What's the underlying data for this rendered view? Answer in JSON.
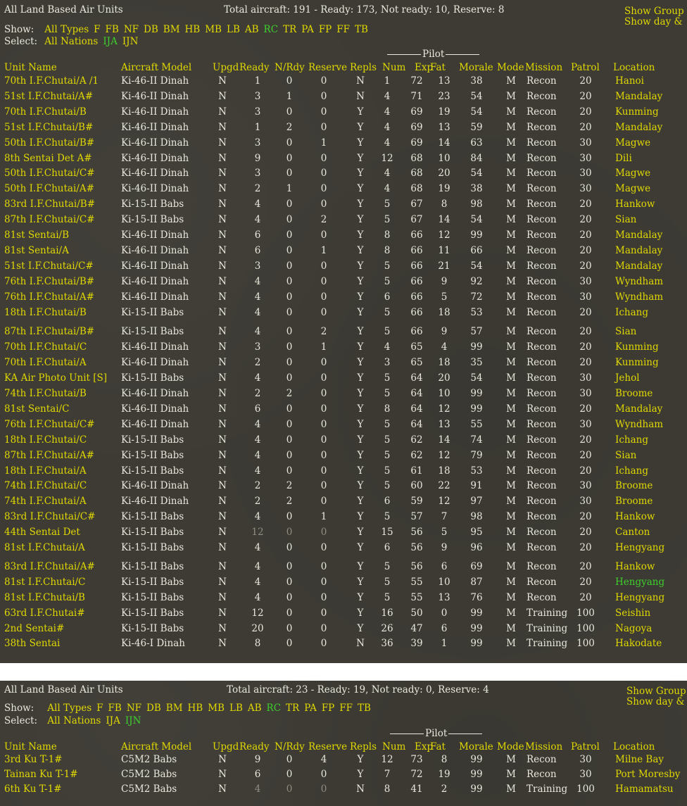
{
  "panels": [
    {
      "title": "All Land Based Air Units",
      "totals": "Total aircraft: 191 - Ready: 173, Not ready: 10, Reserve: 8",
      "show_group": "Show Group",
      "show_day": "Show day &",
      "show_label": "Show:",
      "select_label": "Select:",
      "type_filters": [
        {
          "label": "All Types",
          "on": false
        },
        {
          "label": "F",
          "on": false
        },
        {
          "label": "FB",
          "on": false
        },
        {
          "label": "NF",
          "on": false
        },
        {
          "label": "DB",
          "on": false
        },
        {
          "label": "BM",
          "on": false
        },
        {
          "label": "HB",
          "on": false
        },
        {
          "label": "MB",
          "on": false
        },
        {
          "label": "LB",
          "on": false
        },
        {
          "label": "AB",
          "on": false
        },
        {
          "label": "RC",
          "on": true
        },
        {
          "label": "TR",
          "on": false
        },
        {
          "label": "PA",
          "on": false
        },
        {
          "label": "FP",
          "on": false
        },
        {
          "label": "FF",
          "on": false
        },
        {
          "label": "TB",
          "on": false
        }
      ],
      "nation_filters": [
        {
          "label": "All Nations",
          "on": false
        },
        {
          "label": "IJA",
          "on": true
        },
        {
          "label": "IJN",
          "on": false
        }
      ]
    },
    {
      "title": "All Land Based Air Units",
      "totals": "Total aircraft: 23 - Ready: 19, Not ready: 0, Reserve: 4",
      "show_group": "Show Group S",
      "show_day": "Show day & n",
      "show_label": "Show:",
      "select_label": "Select:",
      "type_filters": [
        {
          "label": "All Types",
          "on": false
        },
        {
          "label": "F",
          "on": false
        },
        {
          "label": "FB",
          "on": false
        },
        {
          "label": "NF",
          "on": false
        },
        {
          "label": "DB",
          "on": false
        },
        {
          "label": "BM",
          "on": false
        },
        {
          "label": "HB",
          "on": false
        },
        {
          "label": "MB",
          "on": false
        },
        {
          "label": "LB",
          "on": false
        },
        {
          "label": "AB",
          "on": false
        },
        {
          "label": "RC",
          "on": true
        },
        {
          "label": "TR",
          "on": false
        },
        {
          "label": "PA",
          "on": false
        },
        {
          "label": "FP",
          "on": false
        },
        {
          "label": "FF",
          "on": false
        },
        {
          "label": "TB",
          "on": false
        }
      ],
      "nation_filters": [
        {
          "label": "All Nations",
          "on": false
        },
        {
          "label": "IJA",
          "on": false
        },
        {
          "label": "IJN",
          "on": true
        }
      ]
    }
  ],
  "pilot_group_label": "Pilot",
  "columns": [
    "Unit Name",
    "Aircraft Model",
    "Upgd",
    "Ready",
    "N/Rdy",
    "Reserve",
    "Repls",
    "Num",
    "Exp",
    "Fat",
    "Morale",
    "Mode",
    "Mission",
    "Patrol",
    "Location"
  ],
  "rows_ija": [
    [
      "70th I.F.Chutai/A /1",
      "Ki-46-II Dinah",
      "N",
      "1",
      "0",
      "0",
      "N",
      "1",
      "72",
      "13",
      "38",
      "M",
      "Recon",
      "20",
      "Hanoi"
    ],
    [
      "51st I.F.Chutai/A#",
      "Ki-46-II Dinah",
      "N",
      "3",
      "1",
      "0",
      "N",
      "4",
      "71",
      "23",
      "54",
      "M",
      "Recon",
      "20",
      "Mandalay"
    ],
    [
      "70th I.F.Chutai/B",
      "Ki-46-II Dinah",
      "N",
      "3",
      "0",
      "0",
      "Y",
      "4",
      "69",
      "19",
      "54",
      "M",
      "Recon",
      "20",
      "Kunming"
    ],
    [
      "51st I.F.Chutai/B#",
      "Ki-46-II Dinah",
      "N",
      "1",
      "2",
      "0",
      "Y",
      "4",
      "69",
      "13",
      "59",
      "M",
      "Recon",
      "20",
      "Mandalay"
    ],
    [
      "50th I.F.Chutai/B#",
      "Ki-46-II Dinah",
      "N",
      "3",
      "0",
      "1",
      "Y",
      "4",
      "69",
      "14",
      "63",
      "M",
      "Recon",
      "30",
      "Magwe"
    ],
    [
      "8th Sentai Det A#",
      "Ki-46-II Dinah",
      "N",
      "9",
      "0",
      "0",
      "Y",
      "12",
      "68",
      "10",
      "84",
      "M",
      "Recon",
      "30",
      "Dili"
    ],
    [
      "50th I.F.Chutai/C#",
      "Ki-46-II Dinah",
      "N",
      "3",
      "0",
      "0",
      "Y",
      "4",
      "68",
      "20",
      "54",
      "M",
      "Recon",
      "30",
      "Magwe"
    ],
    [
      "50th I.F.Chutai/A#",
      "Ki-46-II Dinah",
      "N",
      "2",
      "1",
      "0",
      "Y",
      "4",
      "68",
      "19",
      "38",
      "M",
      "Recon",
      "30",
      "Magwe"
    ],
    [
      "83rd I.F.Chutai/B#",
      "Ki-15-II Babs",
      "N",
      "4",
      "0",
      "0",
      "Y",
      "5",
      "67",
      "8",
      "98",
      "M",
      "Recon",
      "20",
      "Hankow"
    ],
    [
      "87th I.F.Chutai/C#",
      "Ki-15-II Babs",
      "N",
      "4",
      "0",
      "2",
      "Y",
      "5",
      "67",
      "14",
      "54",
      "M",
      "Recon",
      "20",
      "Sian"
    ],
    [
      "81st Sentai/B",
      "Ki-46-II Dinah",
      "N",
      "6",
      "0",
      "0",
      "Y",
      "8",
      "66",
      "12",
      "99",
      "M",
      "Recon",
      "20",
      "Mandalay"
    ],
    [
      "81st Sentai/A",
      "Ki-46-II Dinah",
      "N",
      "6",
      "0",
      "1",
      "Y",
      "8",
      "66",
      "11",
      "66",
      "M",
      "Recon",
      "20",
      "Mandalay"
    ],
    [
      "51st I.F.Chutai/C#",
      "Ki-46-II Dinah",
      "N",
      "3",
      "0",
      "0",
      "Y",
      "5",
      "66",
      "21",
      "54",
      "M",
      "Recon",
      "20",
      "Mandalay"
    ],
    [
      "76th I.F.Chutai/B#",
      "Ki-46-II Dinah",
      "N",
      "4",
      "0",
      "0",
      "Y",
      "5",
      "66",
      "9",
      "92",
      "M",
      "Recon",
      "30",
      "Wyndham"
    ],
    [
      "76th I.F.Chutai/A#",
      "Ki-46-II Dinah",
      "N",
      "4",
      "0",
      "0",
      "Y",
      "6",
      "66",
      "5",
      "72",
      "M",
      "Recon",
      "30",
      "Wyndham"
    ],
    [
      "18th I.F.Chutai/B",
      "Ki-15-II Babs",
      "N",
      "4",
      "0",
      "0",
      "Y",
      "5",
      "66",
      "18",
      "53",
      "M",
      "Recon",
      "20",
      "Ichang"
    ],
    [
      "87th I.F.Chutai/B#",
      "Ki-15-II Babs",
      "N",
      "4",
      "0",
      "2",
      "Y",
      "5",
      "66",
      "9",
      "57",
      "M",
      "Recon",
      "20",
      "Sian"
    ],
    [
      "70th I.F.Chutai/C",
      "Ki-46-II Dinah",
      "N",
      "3",
      "0",
      "1",
      "Y",
      "4",
      "65",
      "4",
      "99",
      "M",
      "Recon",
      "20",
      "Kunming"
    ],
    [
      "70th I.F.Chutai/A",
      "Ki-46-II Dinah",
      "N",
      "2",
      "0",
      "0",
      "Y",
      "3",
      "65",
      "18",
      "35",
      "M",
      "Recon",
      "20",
      "Kunming"
    ],
    [
      "KA Air Photo Unit [S]",
      "Ki-15-II Babs",
      "N",
      "4",
      "0",
      "0",
      "Y",
      "5",
      "64",
      "20",
      "54",
      "M",
      "Recon",
      "30",
      "Jehol"
    ],
    [
      "74th I.F.Chutai/B",
      "Ki-46-II Dinah",
      "N",
      "2",
      "2",
      "0",
      "Y",
      "5",
      "64",
      "10",
      "99",
      "M",
      "Recon",
      "30",
      "Broome"
    ],
    [
      "81st Sentai/C",
      "Ki-46-II Dinah",
      "N",
      "6",
      "0",
      "0",
      "Y",
      "8",
      "64",
      "12",
      "99",
      "M",
      "Recon",
      "20",
      "Mandalay"
    ],
    [
      "76th I.F.Chutai/C#",
      "Ki-46-II Dinah",
      "N",
      "4",
      "0",
      "0",
      "Y",
      "5",
      "64",
      "13",
      "55",
      "M",
      "Recon",
      "30",
      "Wyndham"
    ],
    [
      "18th I.F.Chutai/C",
      "Ki-15-II Babs",
      "N",
      "4",
      "0",
      "0",
      "Y",
      "5",
      "62",
      "14",
      "74",
      "M",
      "Recon",
      "20",
      "Ichang"
    ],
    [
      "87th I.F.Chutai/A#",
      "Ki-15-II Babs",
      "N",
      "4",
      "0",
      "0",
      "Y",
      "5",
      "62",
      "12",
      "79",
      "M",
      "Recon",
      "20",
      "Sian"
    ],
    [
      "18th I.F.Chutai/A",
      "Ki-15-II Babs",
      "N",
      "4",
      "0",
      "0",
      "Y",
      "5",
      "61",
      "18",
      "53",
      "M",
      "Recon",
      "20",
      "Ichang"
    ],
    [
      "74th I.F.Chutai/C",
      "Ki-46-II Dinah",
      "N",
      "2",
      "2",
      "0",
      "Y",
      "5",
      "60",
      "22",
      "91",
      "M",
      "Recon",
      "30",
      "Broome"
    ],
    [
      "74th I.F.Chutai/A",
      "Ki-46-II Dinah",
      "N",
      "2",
      "2",
      "0",
      "Y",
      "6",
      "59",
      "12",
      "97",
      "M",
      "Recon",
      "30",
      "Broome"
    ],
    [
      "83rd I.F.Chutai/C#",
      "Ki-15-II Babs",
      "N",
      "4",
      "0",
      "1",
      "Y",
      "5",
      "57",
      "7",
      "98",
      "M",
      "Recon",
      "20",
      "Hankow"
    ],
    [
      "44th Sentai Det",
      "Ki-15-II Babs",
      "N",
      "12",
      "0",
      "0",
      "Y",
      "15",
      "56",
      "5",
      "95",
      "M",
      "Recon",
      "20",
      "Canton"
    ],
    [
      "81st I.F.Chutai/A",
      "Ki-15-II Babs",
      "N",
      "4",
      "0",
      "0",
      "Y",
      "6",
      "56",
      "9",
      "96",
      "M",
      "Recon",
      "20",
      "Hengyang"
    ],
    [
      "83rd I.F.Chutai/A#",
      "Ki-15-II Babs",
      "N",
      "4",
      "0",
      "0",
      "Y",
      "5",
      "56",
      "6",
      "69",
      "M",
      "Recon",
      "20",
      "Hankow"
    ],
    [
      "81st I.F.Chutai/C",
      "Ki-15-II Babs",
      "N",
      "4",
      "0",
      "0",
      "Y",
      "5",
      "55",
      "10",
      "87",
      "M",
      "Recon",
      "20",
      "Hengyang"
    ],
    [
      "81st I.F.Chutai/B",
      "Ki-15-II Babs",
      "N",
      "4",
      "0",
      "0",
      "Y",
      "5",
      "55",
      "13",
      "76",
      "M",
      "Recon",
      "20",
      "Hengyang"
    ],
    [
      "63rd I.F.Chutai#",
      "Ki-15-II Babs",
      "N",
      "12",
      "0",
      "0",
      "Y",
      "16",
      "50",
      "0",
      "99",
      "M",
      "Training",
      "100",
      "Seishin"
    ],
    [
      "2nd Sentai#",
      "Ki-15-II Babs",
      "N",
      "20",
      "0",
      "0",
      "Y",
      "26",
      "47",
      "6",
      "99",
      "M",
      "Training",
      "100",
      "Nagoya"
    ],
    [
      "38th Sentai",
      "Ki-46-I Dinah",
      "N",
      "8",
      "0",
      "0",
      "N",
      "36",
      "39",
      "1",
      "99",
      "M",
      "Training",
      "100",
      "Hakodate"
    ]
  ],
  "rows_ijn": [
    [
      "3rd Ku T-1#",
      "C5M2 Babs",
      "N",
      "9",
      "0",
      "4",
      "Y",
      "12",
      "73",
      "8",
      "99",
      "M",
      "Recon",
      "30",
      "Milne Bay"
    ],
    [
      "Tainan Ku T-1#",
      "C5M2 Babs",
      "N",
      "6",
      "0",
      "0",
      "Y",
      "7",
      "72",
      "19",
      "99",
      "M",
      "Recon",
      "30",
      "Port Moresby"
    ],
    [
      "6th Ku T-1#",
      "C5M2 Babs",
      "N",
      "4",
      "0",
      "0",
      "N",
      "8",
      "41",
      "2",
      "99",
      "M",
      "Training",
      "100",
      "Hamamatsu"
    ]
  ],
  "highlights": {
    "ija_green_location_row": 32,
    "ija_grey_ready_row": 29,
    "ijn_grey_ready_row": 2
  }
}
